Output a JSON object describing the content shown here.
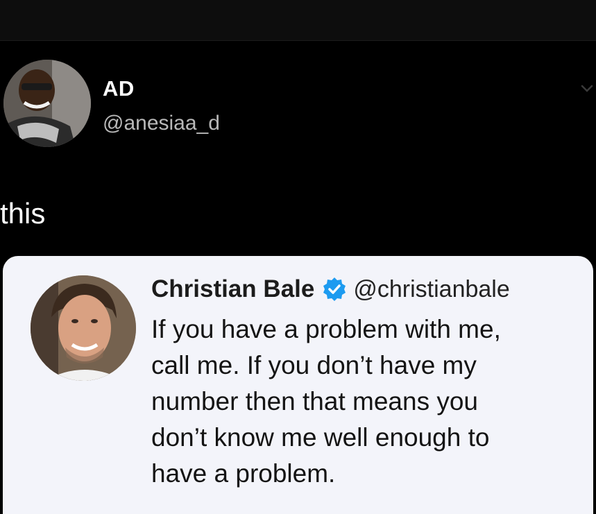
{
  "tweet": {
    "author_name": "AD",
    "author_handle": "@anesiaa_d",
    "text": "this",
    "avatar_icon": "user-avatar",
    "menu_icon": "chevron-down-icon"
  },
  "quoted_tweet": {
    "author_name": "Christian Bale",
    "verified_icon": "verified-badge-icon",
    "verified_color": "#1d9bf0",
    "author_handle": "@christianbale",
    "lines": [
      "If you have a problem with me,",
      "call me. If you don’t have my",
      "number then that means you",
      "don’t know me well enough to",
      "have a problem."
    ]
  },
  "colors": {
    "background": "#000000",
    "card_background": "#f3f4fa",
    "handle_gray": "#b9b9b9"
  }
}
